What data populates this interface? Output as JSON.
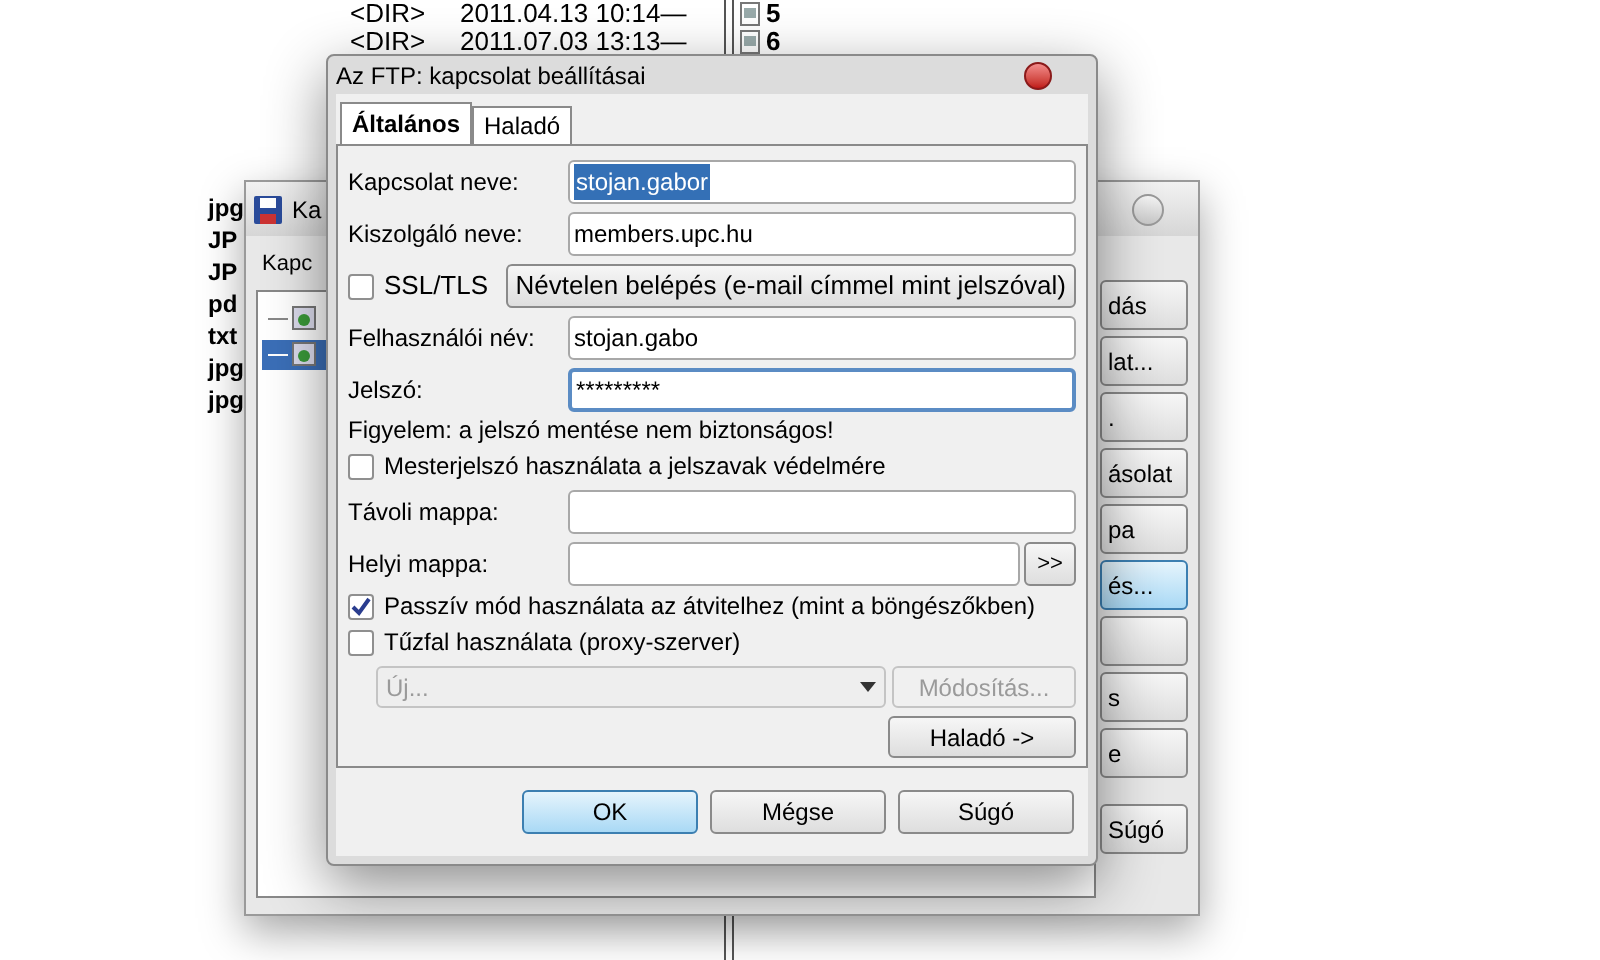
{
  "file_list": {
    "rows": [
      {
        "type": "<DIR>",
        "date": "2011.04.13 10:14—",
        "number": "5"
      },
      {
        "type": "<DIR>",
        "date": "2011.07.03 13:13—",
        "number": "6"
      }
    ]
  },
  "file_types": [
    "jpg",
    "JP",
    "JP",
    "pd",
    "txt",
    "jpg",
    "jpg"
  ],
  "back_window": {
    "title": "Ka",
    "section_label": "Kapc",
    "tree_items": [
      {
        "selected": false
      },
      {
        "selected": true
      }
    ],
    "buttons": [
      {
        "label": "dás",
        "selected": false
      },
      {
        "label": "lat...",
        "selected": false
      },
      {
        "label": ".",
        "selected": false
      },
      {
        "label": "ásolat",
        "selected": false
      },
      {
        "label": "pa",
        "selected": false
      },
      {
        "label": "és...",
        "selected": true
      },
      {
        "selected": false
      },
      {
        "label": "s",
        "selected": false
      },
      {
        "label": "e",
        "selected": false
      },
      {
        "label": "Súgó",
        "selected": false
      }
    ]
  },
  "dialog": {
    "title": "Az FTP: kapcsolat beállításai",
    "tabs": [
      {
        "label": "Általános",
        "selected": true
      },
      {
        "label": "Haladó",
        "selected": false
      }
    ],
    "rows": [
      {
        "kind": "field",
        "label": "Kapcsolat neve:",
        "value": "stojan.gabor",
        "text_selected": true,
        "focused": false
      },
      {
        "kind": "field",
        "label": "Kiszolgáló neve:",
        "value": "members.upc.hu",
        "text_selected": false,
        "focused": false
      },
      {
        "kind": "check_button",
        "label": "SSL/TLS",
        "checked": false,
        "button": "Névtelen belépés (e-mail címmel mint jelszóval)"
      },
      {
        "kind": "field",
        "label": "Felhasználói név:",
        "value": "stojan.gabo",
        "text_selected": false,
        "focused": false
      },
      {
        "kind": "field",
        "label": "Jelszó:",
        "value": "*********",
        "text_selected": false,
        "focused": true
      },
      {
        "kind": "note",
        "text": "Figyelem: a jelszó mentése nem biztonságos!"
      },
      {
        "kind": "checkbox",
        "label": "Mesterjelszó használata a jelszavak védelmére",
        "checked": false
      },
      {
        "kind": "field",
        "label": "Távoli mappa:",
        "focused": false
      },
      {
        "kind": "browse",
        "label": "Helyi mappa:",
        "button": ">>"
      },
      {
        "kind": "checkbox",
        "label": "Passzív mód használata az átvitelhez (mint a böngészőkben)",
        "checked": true
      },
      {
        "kind": "checkbox",
        "label": "Tűzfal használata (proxy-szerver)",
        "checked": false
      },
      {
        "kind": "dropdown",
        "value": "Új...",
        "disabled": true,
        "button": "Módosítás...",
        "button_disabled": true
      },
      {
        "kind": "button",
        "label": "Haladó ->"
      }
    ],
    "buttons": [
      {
        "label": "OK",
        "default": true
      },
      {
        "label": "Mégse",
        "default": false
      },
      {
        "label": "Súgó",
        "default": false
      }
    ]
  }
}
